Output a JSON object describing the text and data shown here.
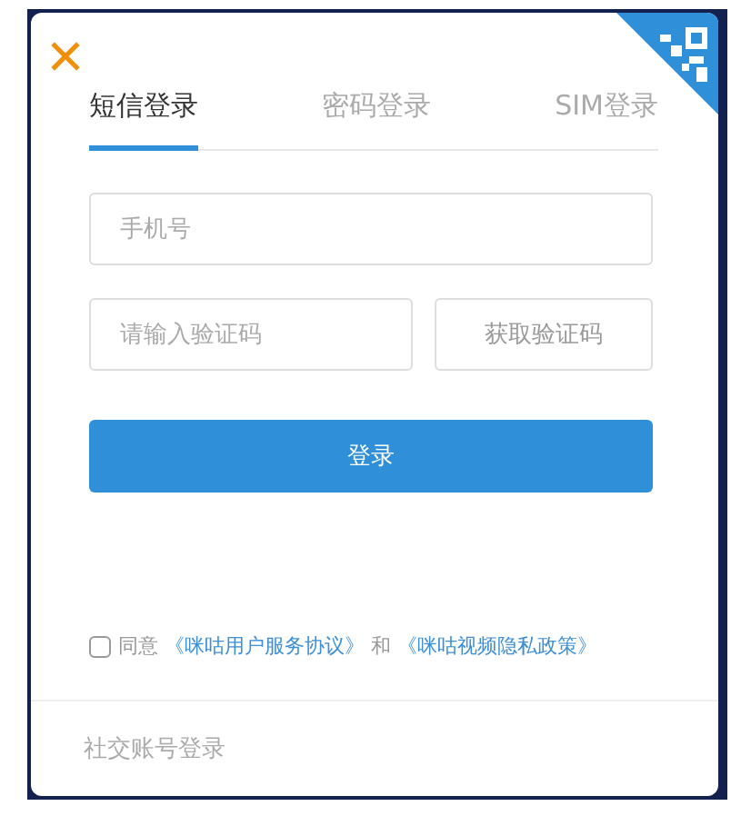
{
  "tabs": [
    {
      "label": "短信登录",
      "selected": true
    },
    {
      "label": "密码登录",
      "selected": false
    },
    {
      "label": "SIM登录",
      "selected": false
    }
  ],
  "phone_field": {
    "placeholder": "手机号"
  },
  "code_field": {
    "placeholder": "请输入验证码"
  },
  "get_code_button": "获取验证码",
  "login_button": "登录",
  "agreement": {
    "checked": false,
    "prefix": "同意",
    "link_1": "《咪咕用户服务协议》",
    "conjunction": "和",
    "link_2": "《咪咕视频隐私政策》"
  },
  "social_login": "社交账号登录"
}
